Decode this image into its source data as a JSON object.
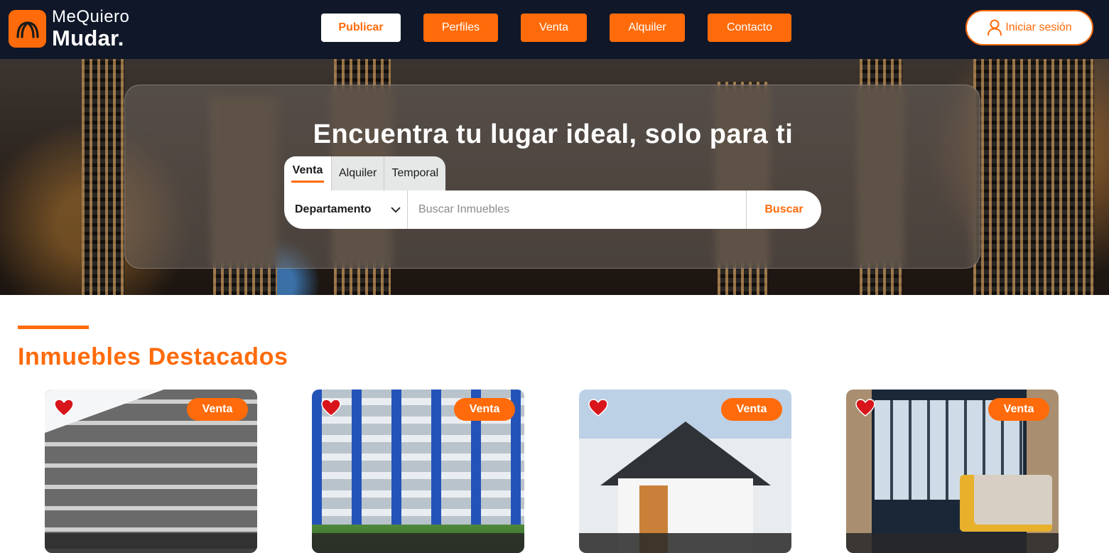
{
  "brand": {
    "line1": "MeQuiero",
    "line2": "Mudar.",
    "accent_color": "#ff6b0a",
    "header_bg": "#0f1729"
  },
  "nav": {
    "items": [
      {
        "label": "Publicar",
        "active": true
      },
      {
        "label": "Perfiles",
        "active": false
      },
      {
        "label": "Venta",
        "active": false
      },
      {
        "label": "Alquiler",
        "active": false
      },
      {
        "label": "Contacto",
        "active": false
      }
    ],
    "login_label": "Iniciar sesión",
    "login_icon": "user-icon"
  },
  "hero": {
    "title": "Encuentra tu lugar ideal, solo para ti",
    "tabs": [
      "Venta",
      "Alquiler",
      "Temporal"
    ],
    "active_tab": "Venta",
    "property_type": "Departamento",
    "search_placeholder": "Buscar Inmuebles",
    "search_button": "Buscar"
  },
  "featured": {
    "title": "Inmuebles Destacados",
    "cards": [
      {
        "badge": "Venta",
        "favorite": true,
        "image": "modern-apartment-building"
      },
      {
        "badge": "Venta",
        "favorite": true,
        "image": "white-blue-tower"
      },
      {
        "badge": "Venta",
        "favorite": true,
        "image": "suburban-house"
      },
      {
        "badge": "Venta",
        "favorite": true,
        "image": "apartment-living-room"
      }
    ]
  }
}
